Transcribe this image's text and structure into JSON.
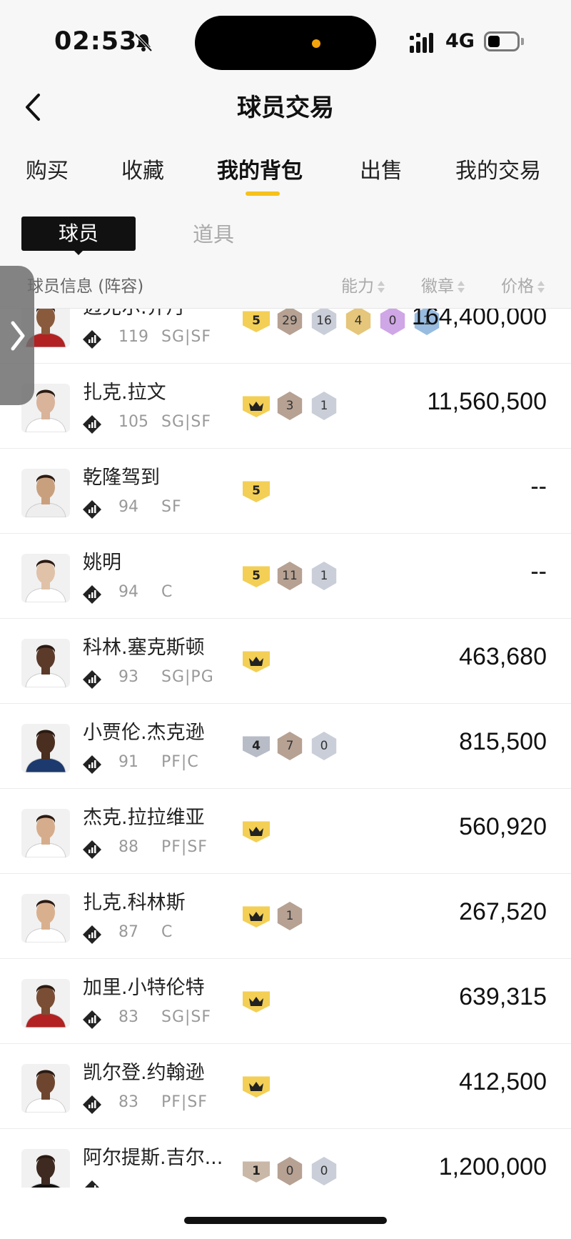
{
  "status_bar": {
    "time": "02:53",
    "network": "4G"
  },
  "header": {
    "title": "球员交易"
  },
  "tabs": [
    {
      "label": "购买",
      "active": false
    },
    {
      "label": "收藏",
      "active": false
    },
    {
      "label": "我的背包",
      "active": true
    },
    {
      "label": "出售",
      "active": false
    },
    {
      "label": "我的交易",
      "active": false
    }
  ],
  "subtabs": {
    "active": "球员",
    "other": "道具"
  },
  "columns": {
    "info": "球员信息 (阵容)",
    "ability": "能力",
    "badge": "徽章",
    "price": "价格"
  },
  "players": [
    {
      "name": "迈克尔.乔丹",
      "ovr": "119",
      "pos": "SG|SF",
      "shield": "5",
      "badges": [
        {
          "count": "29",
          "tier": "hof"
        },
        {
          "count": "16",
          "tier": "silver"
        },
        {
          "count": "4",
          "tier": "gold"
        },
        {
          "count": "0",
          "tier": "purple"
        },
        {
          "count": "1",
          "tier": "blue"
        }
      ],
      "price": "164,400,000"
    },
    {
      "name": "扎克.拉文",
      "ovr": "105",
      "pos": "SG|SF",
      "shield": "crown",
      "badges": [
        {
          "count": "3",
          "tier": "hof"
        },
        {
          "count": "1",
          "tier": "silver"
        }
      ],
      "price": "11,560,500"
    },
    {
      "name": "乾隆驾到",
      "ovr": "94",
      "pos": "SF",
      "shield": "5",
      "badges": [],
      "price": "--"
    },
    {
      "name": "姚明",
      "ovr": "94",
      "pos": "C",
      "shield": "5",
      "badges": [
        {
          "count": "11",
          "tier": "hof"
        },
        {
          "count": "1",
          "tier": "silver"
        }
      ],
      "price": "--"
    },
    {
      "name": "科林.塞克斯顿",
      "ovr": "93",
      "pos": "SG|PG",
      "shield": "crown",
      "badges": [],
      "price": "463,680"
    },
    {
      "name": "小贾伦.杰克逊",
      "ovr": "91",
      "pos": "PF|C",
      "shield": "4",
      "badges": [
        {
          "count": "7",
          "tier": "hof"
        },
        {
          "count": "0",
          "tier": "silver"
        }
      ],
      "price": "815,500"
    },
    {
      "name": "杰克.拉拉维亚",
      "ovr": "88",
      "pos": "PF|SF",
      "shield": "crown",
      "badges": [],
      "price": "560,920"
    },
    {
      "name": "扎克.科林斯",
      "ovr": "87",
      "pos": "C",
      "shield": "crown",
      "badges": [
        {
          "count": "1",
          "tier": "hof"
        }
      ],
      "price": "267,520"
    },
    {
      "name": "加里.小特伦特",
      "ovr": "83",
      "pos": "SG|SF",
      "shield": "crown",
      "badges": [],
      "price": "639,315"
    },
    {
      "name": "凯尔登.约翰逊",
      "ovr": "83",
      "pos": "PF|SF",
      "shield": "crown",
      "badges": [],
      "price": "412,500"
    },
    {
      "name": "阿尔提斯.吉尔...",
      "ovr": "",
      "pos": "",
      "shield": "bronze1",
      "badges": [
        {
          "count": "0",
          "tier": "hof"
        },
        {
          "count": "0",
          "tier": "silver"
        }
      ],
      "price": "1,200,000"
    }
  ]
}
